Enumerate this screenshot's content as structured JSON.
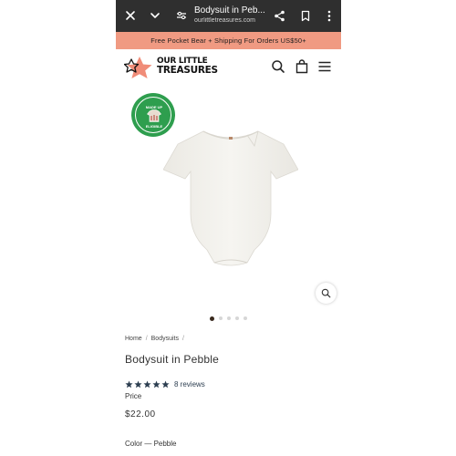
{
  "browser": {
    "title": "Bodysuit in Peb...",
    "url": "ourlittletreasures.com",
    "icons": [
      "close-icon",
      "chevron-down-icon",
      "tune-icon",
      "share-icon",
      "bookmark-icon",
      "more-icon"
    ]
  },
  "promo": {
    "text": "Free Pocket Bear + Shipping For Orders US$50+"
  },
  "header": {
    "logo_line1": "OUR LITTLE",
    "logo_line2": "TREASURES",
    "icons": [
      "search-icon",
      "bag-icon",
      "menu-icon"
    ]
  },
  "gallery": {
    "badge_top": "MADE UP",
    "badge_bottom": "ELIGIBLE",
    "image_count": 5,
    "active_index": 0,
    "icons": [
      "zoom-icon"
    ]
  },
  "breadcrumb": {
    "home": "Home",
    "category": "Bodysuits",
    "separator": "/"
  },
  "product": {
    "title": "Bodysuit in Pebble",
    "rating": 5,
    "reviews": "8 reviews",
    "price_label": "Price",
    "price": "$22.00",
    "color_label": "Color — Pebble"
  },
  "colors": {
    "browser_bar": "#2f2f2f",
    "promo_bg": "#f09a82",
    "logo_star": "#f08c78",
    "badge_green": "#2e9e4e",
    "star_color": "#2c3e50"
  }
}
